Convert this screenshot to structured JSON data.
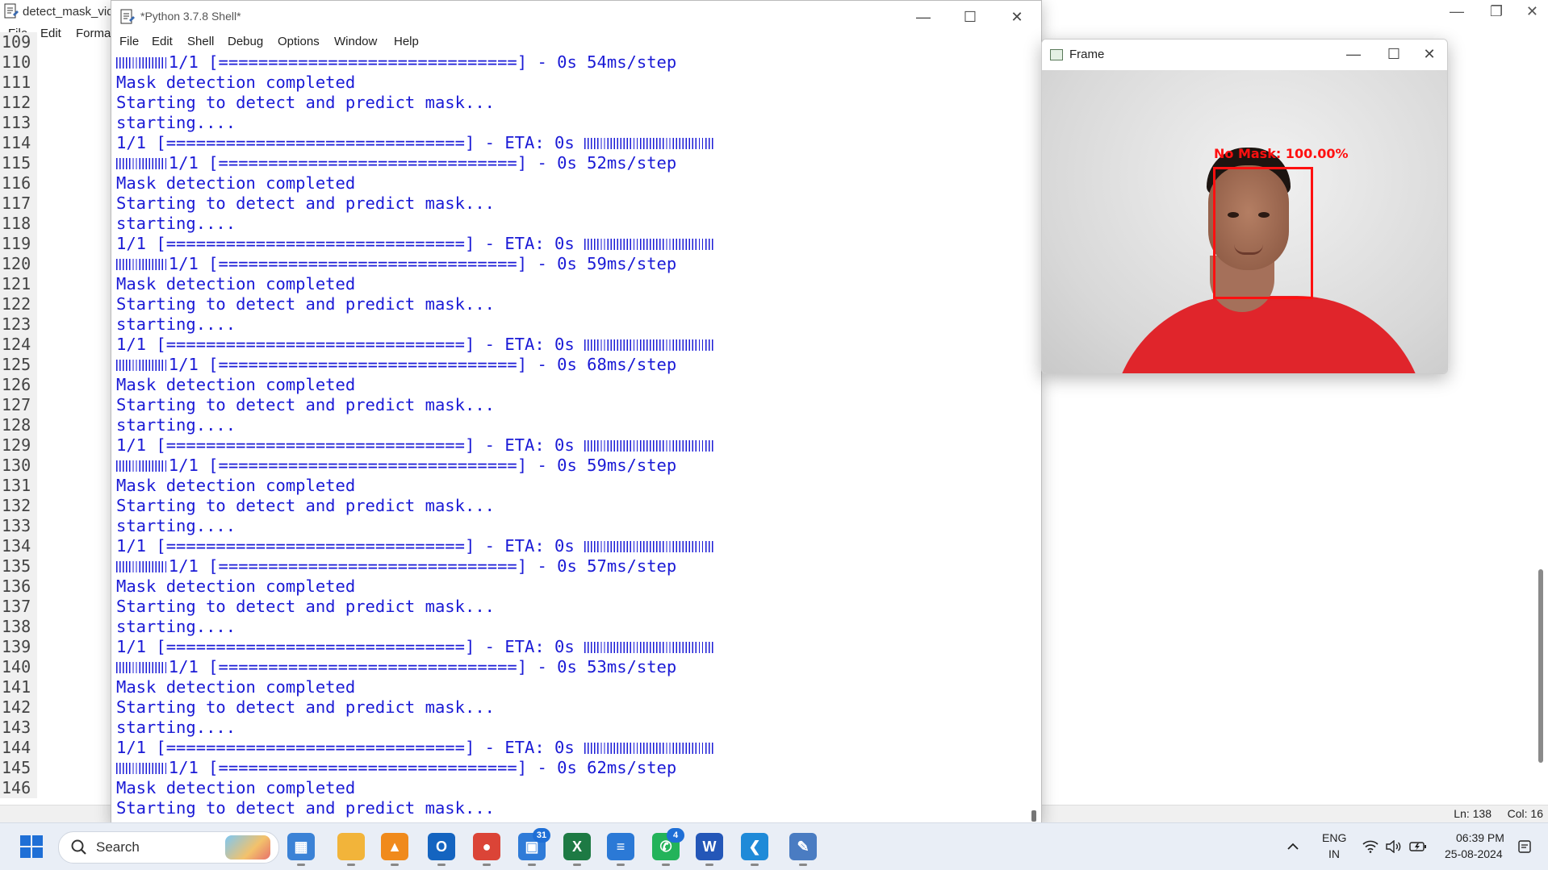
{
  "bg_editor": {
    "title": "detect_mask_vid",
    "menu": [
      "File",
      "Edit",
      "Forma"
    ],
    "line_numbers": [
      "109",
      "110",
      "111",
      "112",
      "113",
      "114",
      "115",
      "116",
      "117",
      "118",
      "119",
      "120",
      "121",
      "122",
      "123",
      "124",
      "125",
      "126",
      "127",
      "128",
      "129",
      "130",
      "131",
      "132",
      "133",
      "134",
      "135",
      "136",
      "137",
      "138",
      "139",
      "140",
      "141",
      "142",
      "143",
      "144",
      "145",
      "146"
    ],
    "status_ln": "Ln: 138",
    "status_col": "Col: 16"
  },
  "shell": {
    "title": "*Python 3.7.8 Shell*",
    "menu": [
      "File",
      "Edit",
      "Shell",
      "Debug",
      "Options",
      "Window",
      "Help"
    ],
    "lines": [
      {
        "pre": 16,
        "text": "1/1 [==============================] - 0s 54ms/step",
        "post": 0
      },
      {
        "pre": 0,
        "text": "Mask detection completed",
        "post": 0
      },
      {
        "pre": 0,
        "text": "Starting to detect and predict mask...",
        "post": 0
      },
      {
        "pre": 0,
        "text": "starting....",
        "post": 0
      },
      {
        "pre": 0,
        "text": "1/1 [==============================] - ETA: 0s ",
        "post": 40
      },
      {
        "pre": 16,
        "text": "1/1 [==============================] - 0s 52ms/step",
        "post": 0
      },
      {
        "pre": 0,
        "text": "Mask detection completed",
        "post": 0
      },
      {
        "pre": 0,
        "text": "Starting to detect and predict mask...",
        "post": 0
      },
      {
        "pre": 0,
        "text": "starting....",
        "post": 0
      },
      {
        "pre": 0,
        "text": "1/1 [==============================] - ETA: 0s ",
        "post": 40
      },
      {
        "pre": 16,
        "text": "1/1 [==============================] - 0s 59ms/step",
        "post": 0
      },
      {
        "pre": 0,
        "text": "Mask detection completed",
        "post": 0
      },
      {
        "pre": 0,
        "text": "Starting to detect and predict mask...",
        "post": 0
      },
      {
        "pre": 0,
        "text": "starting....",
        "post": 0
      },
      {
        "pre": 0,
        "text": "1/1 [==============================] - ETA: 0s ",
        "post": 40
      },
      {
        "pre": 16,
        "text": "1/1 [==============================] - 0s 68ms/step",
        "post": 0
      },
      {
        "pre": 0,
        "text": "Mask detection completed",
        "post": 0
      },
      {
        "pre": 0,
        "text": "Starting to detect and predict mask...",
        "post": 0
      },
      {
        "pre": 0,
        "text": "starting....",
        "post": 0
      },
      {
        "pre": 0,
        "text": "1/1 [==============================] - ETA: 0s ",
        "post": 40
      },
      {
        "pre": 16,
        "text": "1/1 [==============================] - 0s 59ms/step",
        "post": 0
      },
      {
        "pre": 0,
        "text": "Mask detection completed",
        "post": 0
      },
      {
        "pre": 0,
        "text": "Starting to detect and predict mask...",
        "post": 0
      },
      {
        "pre": 0,
        "text": "starting....",
        "post": 0
      },
      {
        "pre": 0,
        "text": "1/1 [==============================] - ETA: 0s ",
        "post": 40
      },
      {
        "pre": 16,
        "text": "1/1 [==============================] - 0s 57ms/step",
        "post": 0
      },
      {
        "pre": 0,
        "text": "Mask detection completed",
        "post": 0
      },
      {
        "pre": 0,
        "text": "Starting to detect and predict mask...",
        "post": 0
      },
      {
        "pre": 0,
        "text": "starting....",
        "post": 0
      },
      {
        "pre": 0,
        "text": "1/1 [==============================] - ETA: 0s ",
        "post": 40
      },
      {
        "pre": 16,
        "text": "1/1 [==============================] - 0s 53ms/step",
        "post": 0
      },
      {
        "pre": 0,
        "text": "Mask detection completed",
        "post": 0
      },
      {
        "pre": 0,
        "text": "Starting to detect and predict mask...",
        "post": 0
      },
      {
        "pre": 0,
        "text": "starting....",
        "post": 0
      },
      {
        "pre": 0,
        "text": "1/1 [==============================] - ETA: 0s ",
        "post": 40
      },
      {
        "pre": 16,
        "text": "1/1 [==============================] - 0s 62ms/step",
        "post": 0
      },
      {
        "pre": 0,
        "text": "Mask detection completed",
        "post": 0
      },
      {
        "pre": 0,
        "text": "Starting to detect and predict mask...",
        "post": 0
      }
    ]
  },
  "frame": {
    "title": "Frame",
    "detection_label": "No Mask: 100.00%",
    "detection_color": "#ff1010"
  },
  "taskbar": {
    "search_label": "Search",
    "icons": [
      {
        "name": "start-icon",
        "glyph": "",
        "color": "#1f6fd6",
        "badge": ""
      },
      {
        "name": "microsoft-store-icon",
        "glyph": "▦",
        "color": "#3b82d6",
        "badge": ""
      },
      {
        "name": "file-explorer-icon",
        "glyph": "",
        "color": "#f2b43a",
        "badge": ""
      },
      {
        "name": "vlc-icon",
        "glyph": "▲",
        "color": "#f08a1c",
        "badge": ""
      },
      {
        "name": "outlook-icon",
        "glyph": "O",
        "color": "#1464c0",
        "badge": ""
      },
      {
        "name": "chrome-icon",
        "glyph": "●",
        "color": "#db4437",
        "badge": ""
      },
      {
        "name": "calendar-app-icon",
        "glyph": "▣",
        "color": "#2f7bd8",
        "badge": "31"
      },
      {
        "name": "excel-icon",
        "glyph": "X",
        "color": "#1d7a44",
        "badge": ""
      },
      {
        "name": "notepad-icon",
        "glyph": "≡",
        "color": "#2b79d6",
        "badge": ""
      },
      {
        "name": "whatsapp-icon",
        "glyph": "✆",
        "color": "#23b35a",
        "badge": "4"
      },
      {
        "name": "word-icon",
        "glyph": "W",
        "color": "#2457b8",
        "badge": ""
      },
      {
        "name": "vscode-icon",
        "glyph": "❮",
        "color": "#1f8ad8",
        "badge": ""
      },
      {
        "name": "python-idle-icon",
        "glyph": "✎",
        "color": "#4a7cc2",
        "badge": ""
      }
    ],
    "lang_top": "ENG",
    "lang_bottom": "IN",
    "time": "06:39 PM",
    "date": "25-08-2024"
  }
}
